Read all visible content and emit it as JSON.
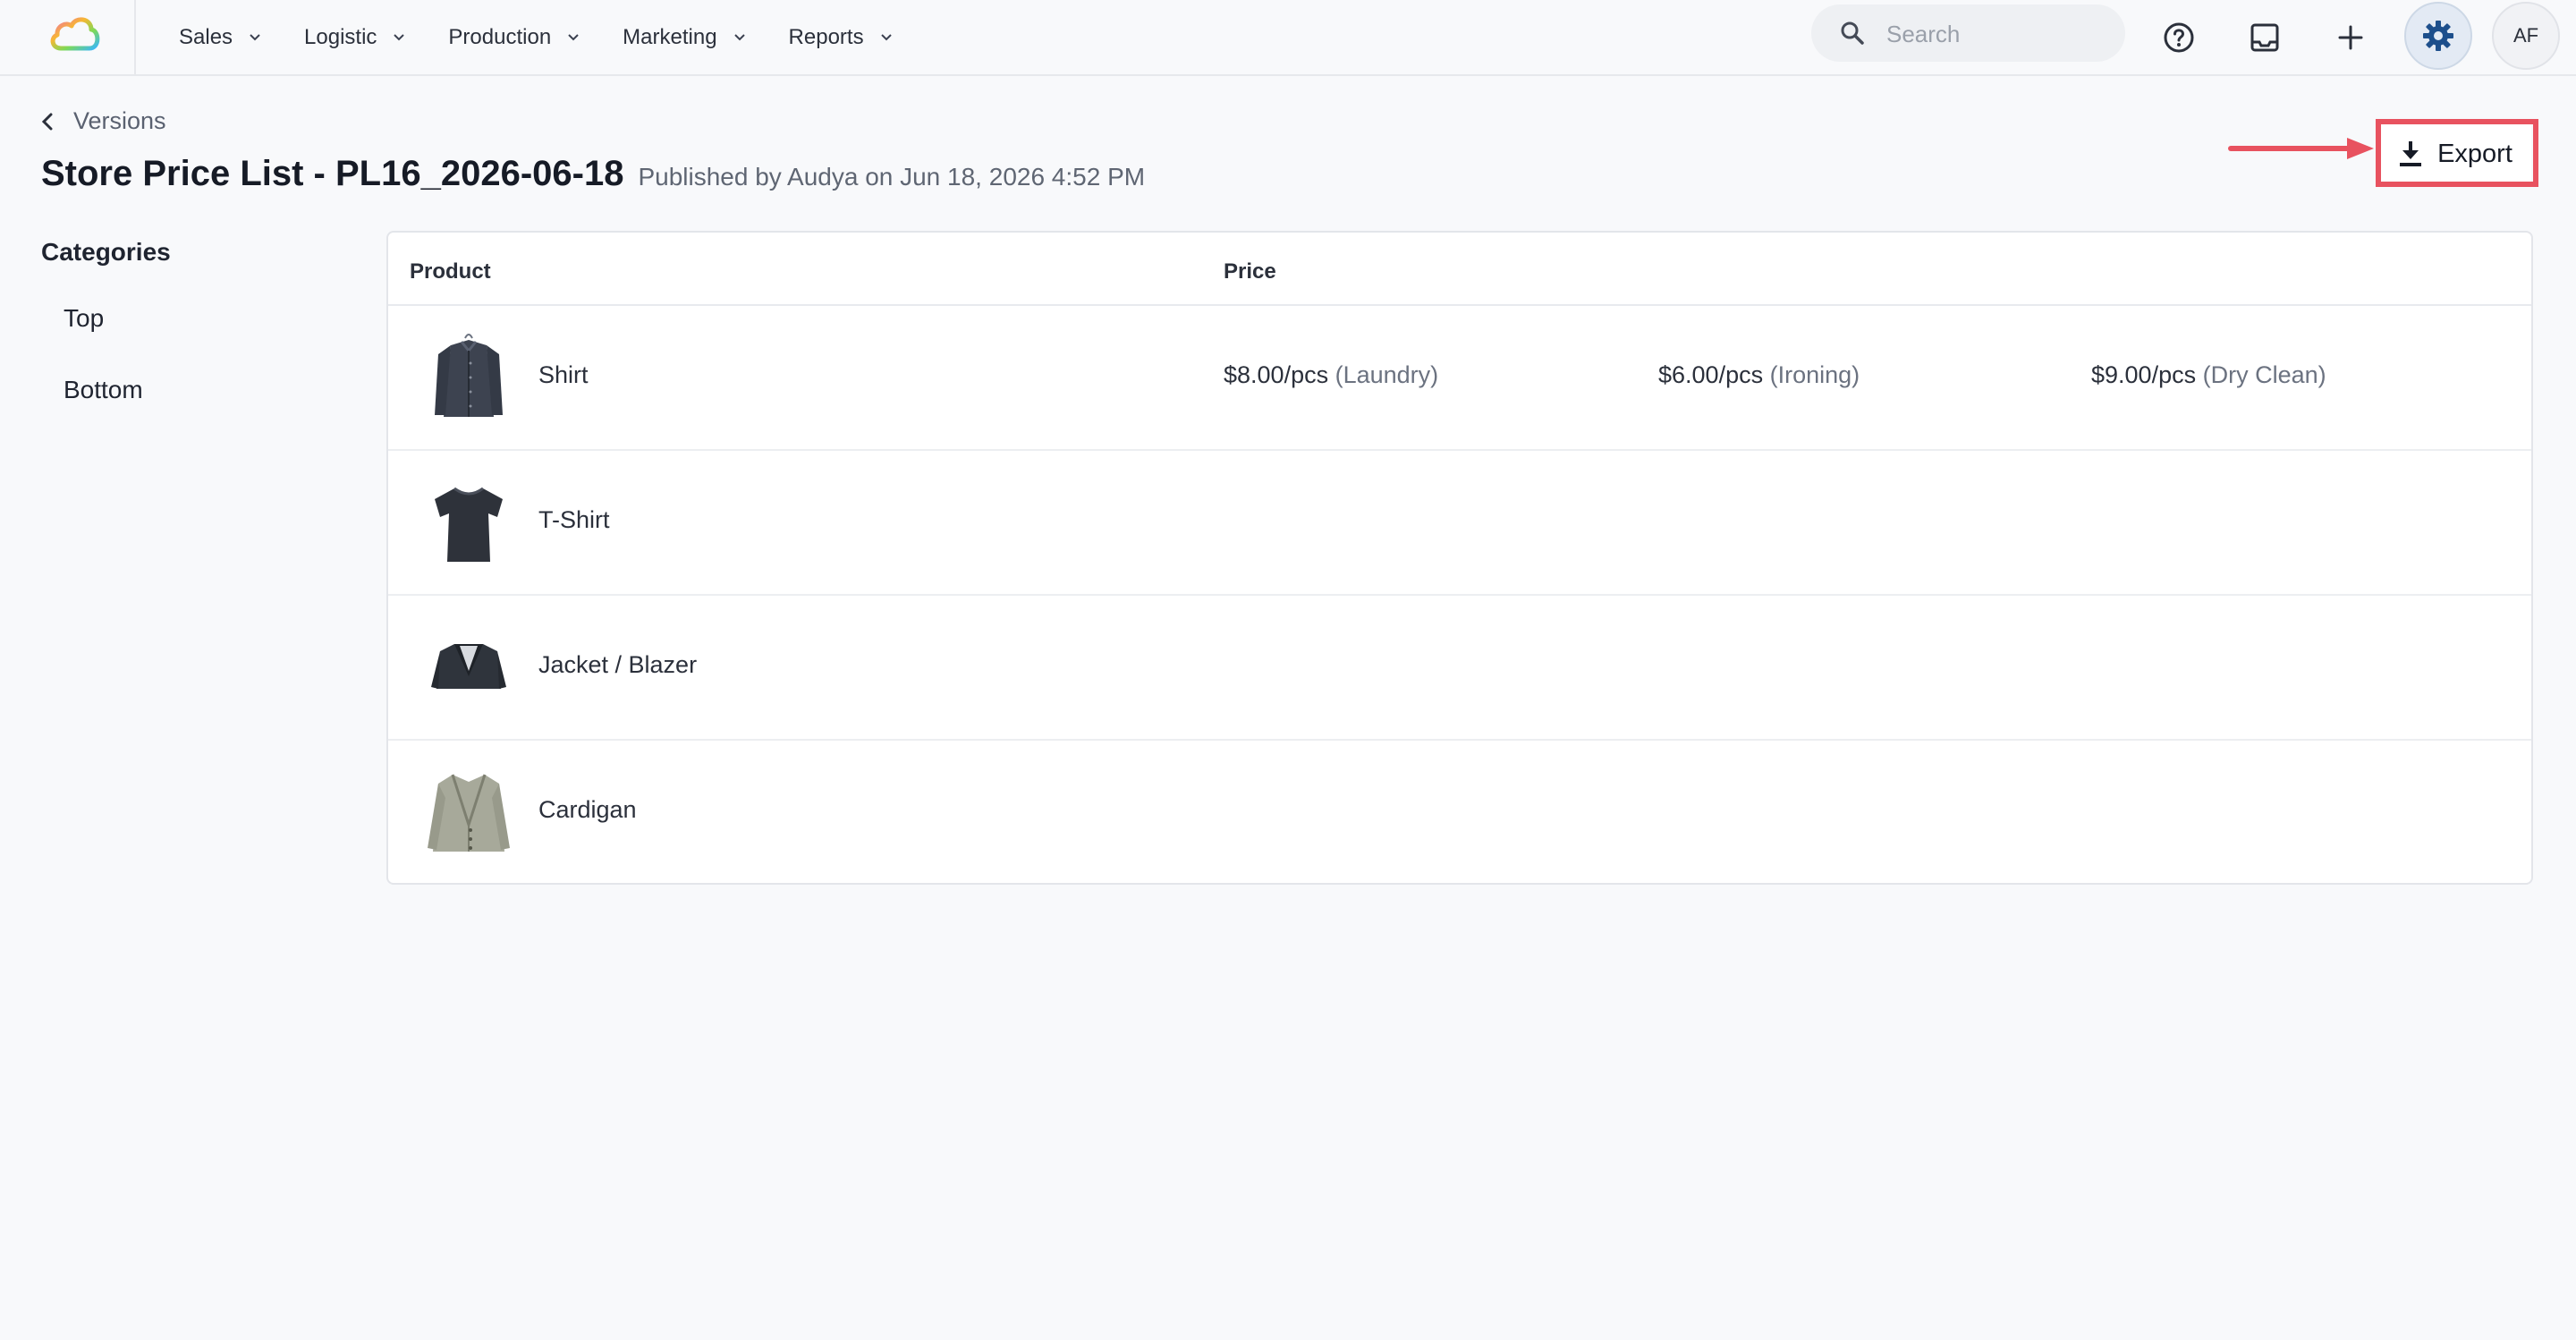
{
  "nav": {
    "items": [
      {
        "label": "Sales"
      },
      {
        "label": "Logistic"
      },
      {
        "label": "Production"
      },
      {
        "label": "Marketing"
      },
      {
        "label": "Reports"
      }
    ]
  },
  "search": {
    "placeholder": "Search"
  },
  "user": {
    "initials": "AF"
  },
  "header": {
    "back_label": "Versions",
    "title": "Store Price List - PL16_2026-06-18",
    "published": "Published by Audya on Jun 18, 2026 4:52 PM",
    "export_label": "Export"
  },
  "sidebar": {
    "heading": "Categories",
    "items": [
      {
        "label": "Top"
      },
      {
        "label": "Bottom"
      }
    ]
  },
  "table": {
    "columns": {
      "product": "Product",
      "price": "Price"
    },
    "rows": [
      {
        "name": "Shirt",
        "image": "shirt-image",
        "prices": [
          {
            "amount": "$8.00/pcs",
            "service": "(Laundry)"
          },
          {
            "amount": "$6.00/pcs",
            "service": "(Ironing)"
          },
          {
            "amount": "$9.00/pcs",
            "service": "(Dry Clean)"
          }
        ]
      },
      {
        "name": "T-Shirt",
        "image": "tshirt-image",
        "prices": []
      },
      {
        "name": "Jacket / Blazer",
        "image": "jacket-image",
        "prices": []
      },
      {
        "name": "Cardigan",
        "image": "cardigan-image",
        "prices": []
      }
    ]
  },
  "colors": {
    "accent": "#1d4f8c",
    "highlight": "#e8525f",
    "background": "#f8f9fb"
  },
  "icons": [
    "cloud-logo-icon",
    "chevron-down-icon",
    "search-icon",
    "help-icon",
    "inbox-icon",
    "plus-icon",
    "gear-icon",
    "chevron-left-icon",
    "download-icon"
  ]
}
